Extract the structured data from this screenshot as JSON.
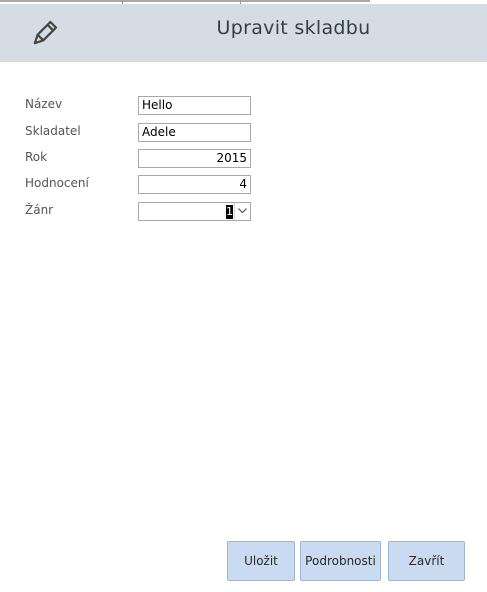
{
  "header": {
    "title": "Upravit skladbu",
    "icon": "pencil-icon"
  },
  "form": {
    "fields": [
      {
        "label": "Název",
        "value": "Hello"
      },
      {
        "label": "Skladatel",
        "value": "Adele"
      },
      {
        "label": "Rok",
        "value": "2015"
      },
      {
        "label": "Hodnocení",
        "value": "4"
      },
      {
        "label": "Žánr",
        "value": "1"
      }
    ]
  },
  "buttons": {
    "save": "Uložit",
    "details": "Podrobnosti",
    "close": "Zavřít"
  },
  "colors": {
    "header_bg": "#d6dce4",
    "button_bg": "#c9daf1",
    "button_border": "#9fb5d1"
  }
}
